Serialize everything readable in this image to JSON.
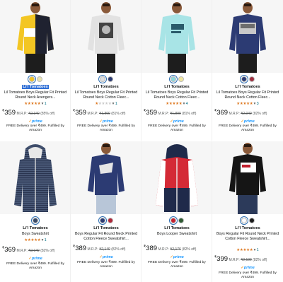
{
  "products": [
    {
      "brand": "Li'l Tomatoes",
      "title": "Lil Tomatoes Boys Regular Fit Printed Round Neck Avengers...",
      "swatches": [
        "#f3c623",
        "#e8e3b0"
      ],
      "stars": 5,
      "rating_count": "1",
      "price": "359",
      "mrp_label": "M.R.P:",
      "mrp": "₹2,349",
      "discount": "(85% off)",
      "prime": "prime",
      "delivery": "FREE Delivery over ₹499. Fulfilled by Amazon",
      "brand_highlighted": true,
      "icon": "colorblock-sweatshirt-photo"
    },
    {
      "brand": "Li'l Tomatoes",
      "title": "Lil Tomatoes Boys Regular Fit Printed Round Neck Cotton Fleec...",
      "swatches": [
        "#dedede",
        "#2c3b73"
      ],
      "stars": 1,
      "rating_count": "1",
      "price": "359",
      "mrp_label": "M.R.P:",
      "mrp": "₹1,899",
      "discount": "(81% off)",
      "prime": "prime",
      "delivery": "FREE Delivery over ₹499. Fulfilled by Amazon",
      "icon": "grey-print-sweatshirt-photo"
    },
    {
      "brand": "Li'l Tomatoes",
      "title": "Lil Tomatoes Boys Regular Fit Printed Round Neck Cotton Fleec...",
      "swatches": [
        "#8fd8dc",
        "#f0e6a0"
      ],
      "stars": 5,
      "rating_count": "4",
      "price": "359",
      "mrp_label": "M.R.P:",
      "mrp": "₹1,899",
      "discount": "(81% off)",
      "prime": "prime",
      "delivery": "FREE Delivery over ₹499. Fulfilled by Amazon",
      "icon": "aqua-sweatshirt-photo"
    },
    {
      "brand": "Li'l Tomatoes",
      "title": "Lil Tomatoes Boys Regular Fit Printed Round Neck Cotton Fleec...",
      "swatches": [
        "#2c3b73",
        "#a03040"
      ],
      "stars": 5,
      "rating_count": "3",
      "price": "369",
      "mrp_label": "M.R.P:",
      "mrp": "₹2,049",
      "discount": "(82% off)",
      "prime": "prime",
      "delivery": "FREE Delivery over ₹499. Fulfilled by Amazon",
      "icon": "navy-print-sweatshirt-photo"
    },
    {
      "brand": "Li'l Tomatoes",
      "title": "Boys Sweatshirt",
      "swatches": [
        "#3a4a66"
      ],
      "stars": 5,
      "rating_count": "1",
      "price": "369",
      "mrp_label": "M.R.P:",
      "mrp": "₹2,049",
      "discount": "(82% off)",
      "prime": "prime",
      "delivery": "FREE Delivery over ₹499. Fulfilled by Amazon",
      "icon": "striped-zip-hoodie-photo"
    },
    {
      "brand": "Li'l Tomatoes",
      "title": "Boys Regular Fit Round Neck Printed Cotton Fleece Sweatshirt...",
      "swatches": [
        "#2c3b73",
        "#b0283a"
      ],
      "stars": 0,
      "rating_count": "",
      "price": "389",
      "mrp_label": "M.R.P:",
      "mrp": "₹2,149",
      "discount": "(82% off)",
      "prime": "prime",
      "delivery": "FREE Delivery over ₹499. Fulfilled by Amazon",
      "icon": "navy-graphic-sweatshirt-photo"
    },
    {
      "brand": "Li'l Tomatoes",
      "title": "Boys Looper Sweatshirt",
      "swatches": [
        "#c8202e",
        "#2e5a32"
      ],
      "stars": 0,
      "rating_count": "",
      "price": "389",
      "mrp_label": "M.R.P:",
      "mrp": "₹2,176",
      "discount": "(82% off)",
      "prime": "prime",
      "delivery": "FREE Delivery over ₹499. Fulfilled by Amazon",
      "icon": "red-colorblock-hoodie-photo"
    },
    {
      "brand": "Li'l Tomatoes",
      "title": "Boys Regular Fit Round Neck Printed Cotton Fleece Sweatshirt...",
      "swatches": [
        "#ffffff",
        "#1a1a1a"
      ],
      "stars": 5,
      "rating_count": "1",
      "price": "399",
      "mrp_label": "M.R.P:",
      "mrp": "₹2,199",
      "discount": "(82% off)",
      "prime": "prime",
      "delivery": "FREE Delivery over ₹499. Fulfilled by Amazon",
      "icon": "black-graphic-sweatshirt-photo"
    }
  ],
  "colors": {
    "price": "#0f1111",
    "rating_star": "#de7921",
    "prime_blue": "#1a98ff",
    "link": "#007185",
    "brand_highlight": "#2f6fd6"
  }
}
